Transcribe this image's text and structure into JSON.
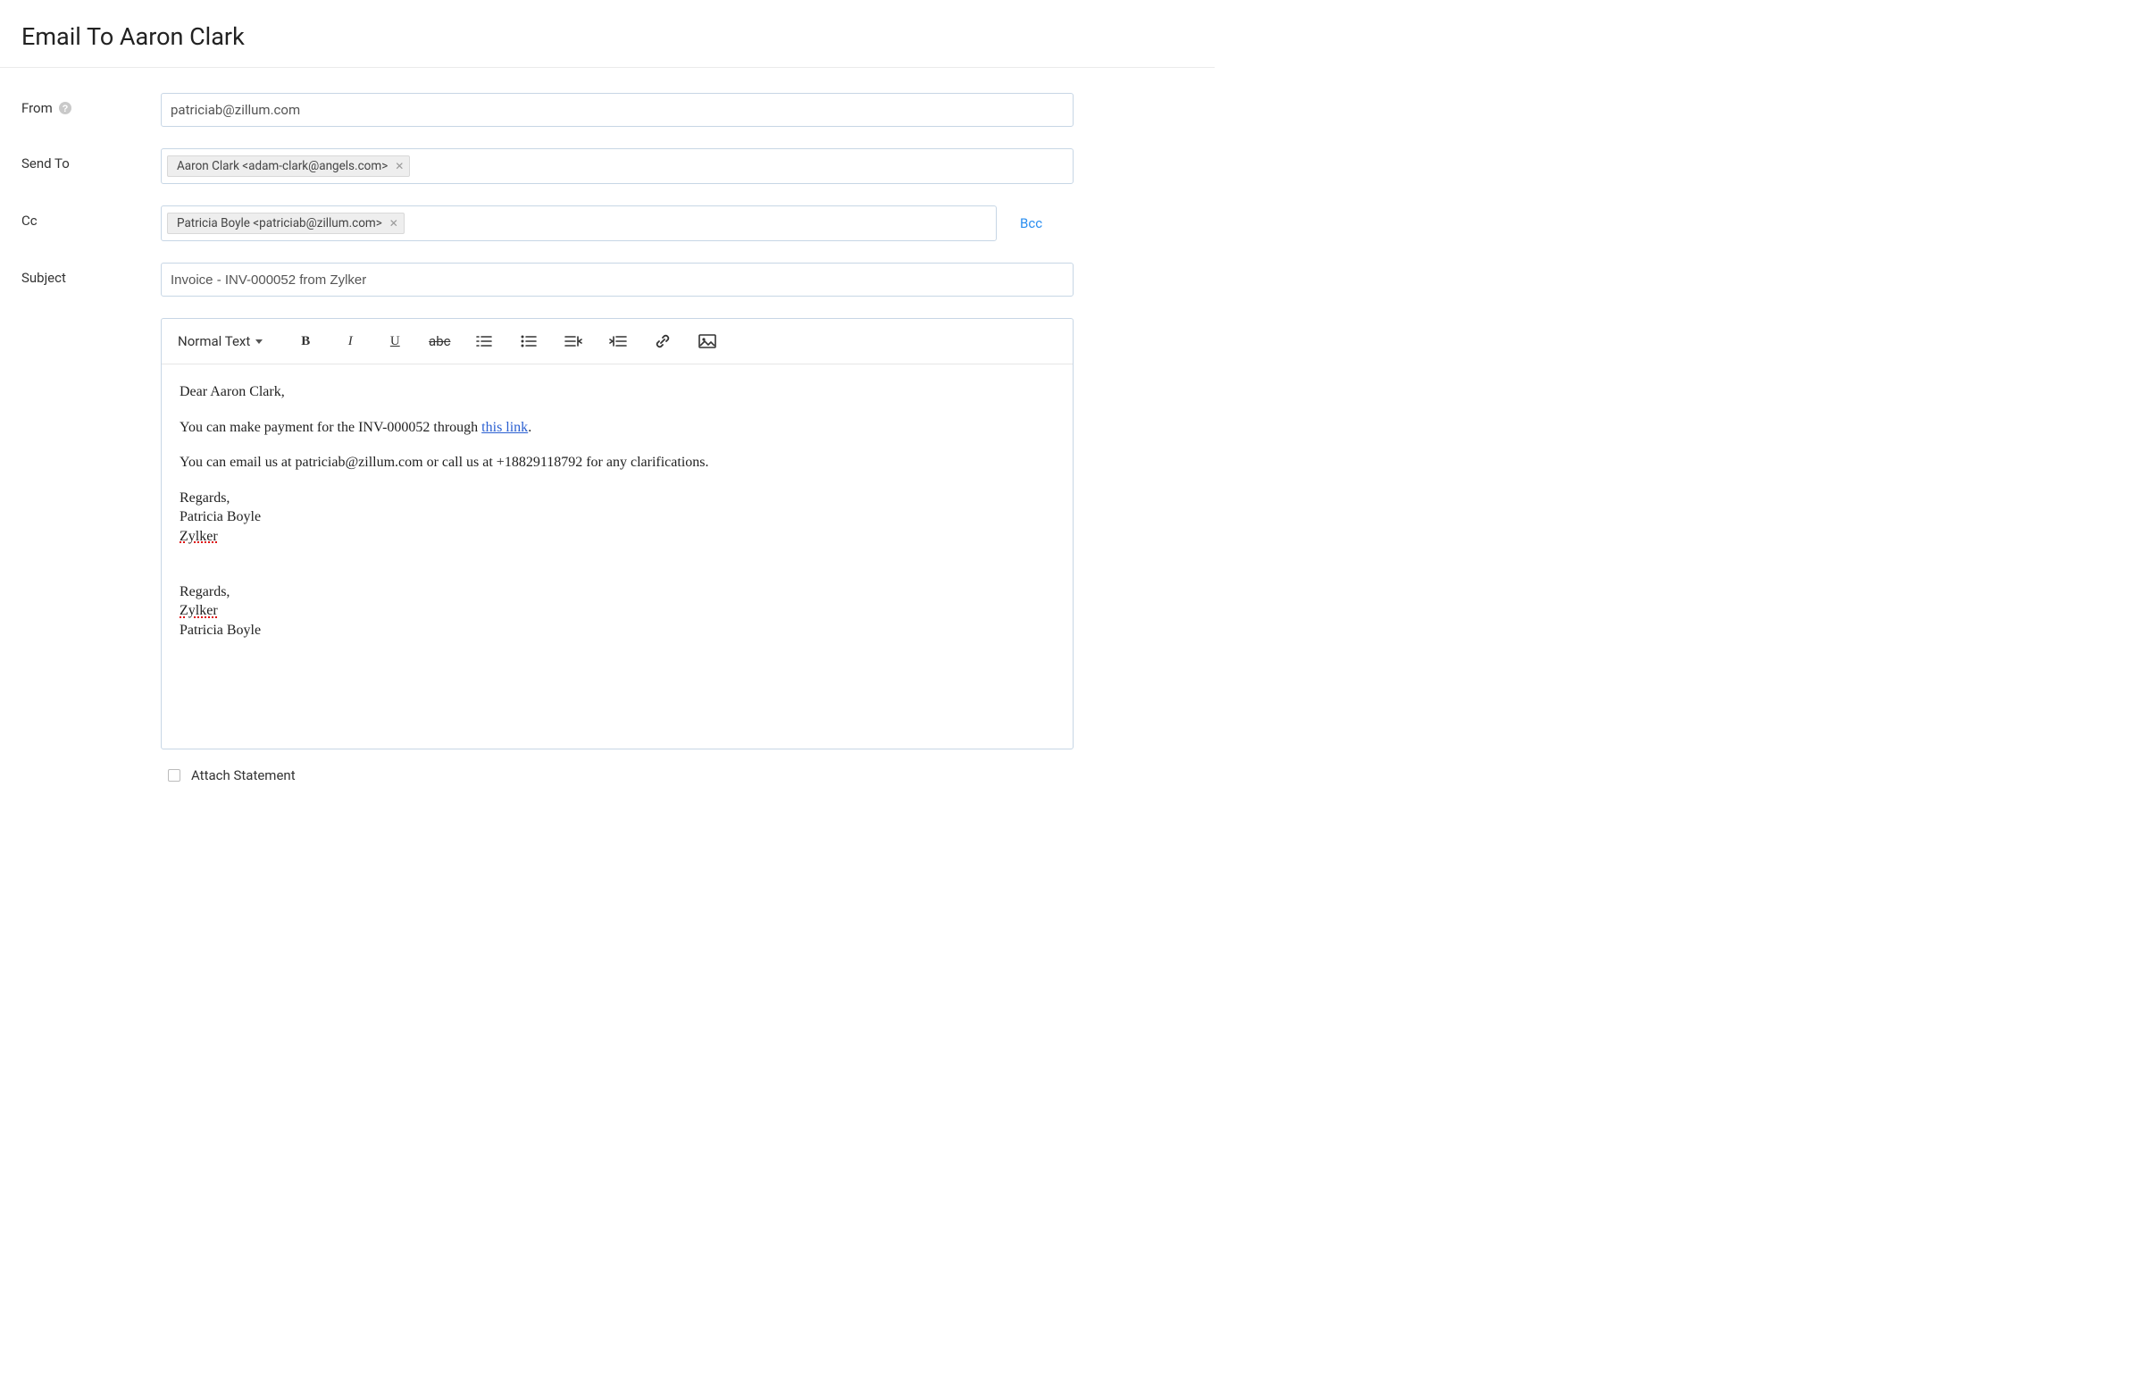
{
  "page_title": "Email To Aaron Clark",
  "labels": {
    "from": "From",
    "send_to": "Send To",
    "cc": "Cc",
    "subject": "Subject"
  },
  "from_value": "patriciab@zillum.com",
  "send_to_chip": "Aaron Clark <adam-clark@angels.com>",
  "cc_chip": "Patricia Boyle <patriciab@zillum.com>",
  "bcc_label": "Bcc",
  "subject_value": "Invoice - INV-000052 from Zylker",
  "toolbar": {
    "format_label": "Normal Text",
    "bold": "B",
    "italic": "I",
    "underline": "U",
    "strike": "abc"
  },
  "body": {
    "greeting": "Dear Aaron Clark,",
    "line2_pre": "You can make payment for the INV-000052 through ",
    "line2_link": "this link",
    "line2_post": ".",
    "line3": "You can email us at patriciab@zillum.com or call us at +18829118792 for any clarifications.",
    "sig1_regards": "Regards,",
    "sig1_name": "Patricia Boyle",
    "sig1_company": "Zylker",
    "sig2_regards": "Regards,",
    "sig2_company": "Zylker",
    "sig2_name": "Patricia Boyle"
  },
  "attach_label": "Attach Statement"
}
